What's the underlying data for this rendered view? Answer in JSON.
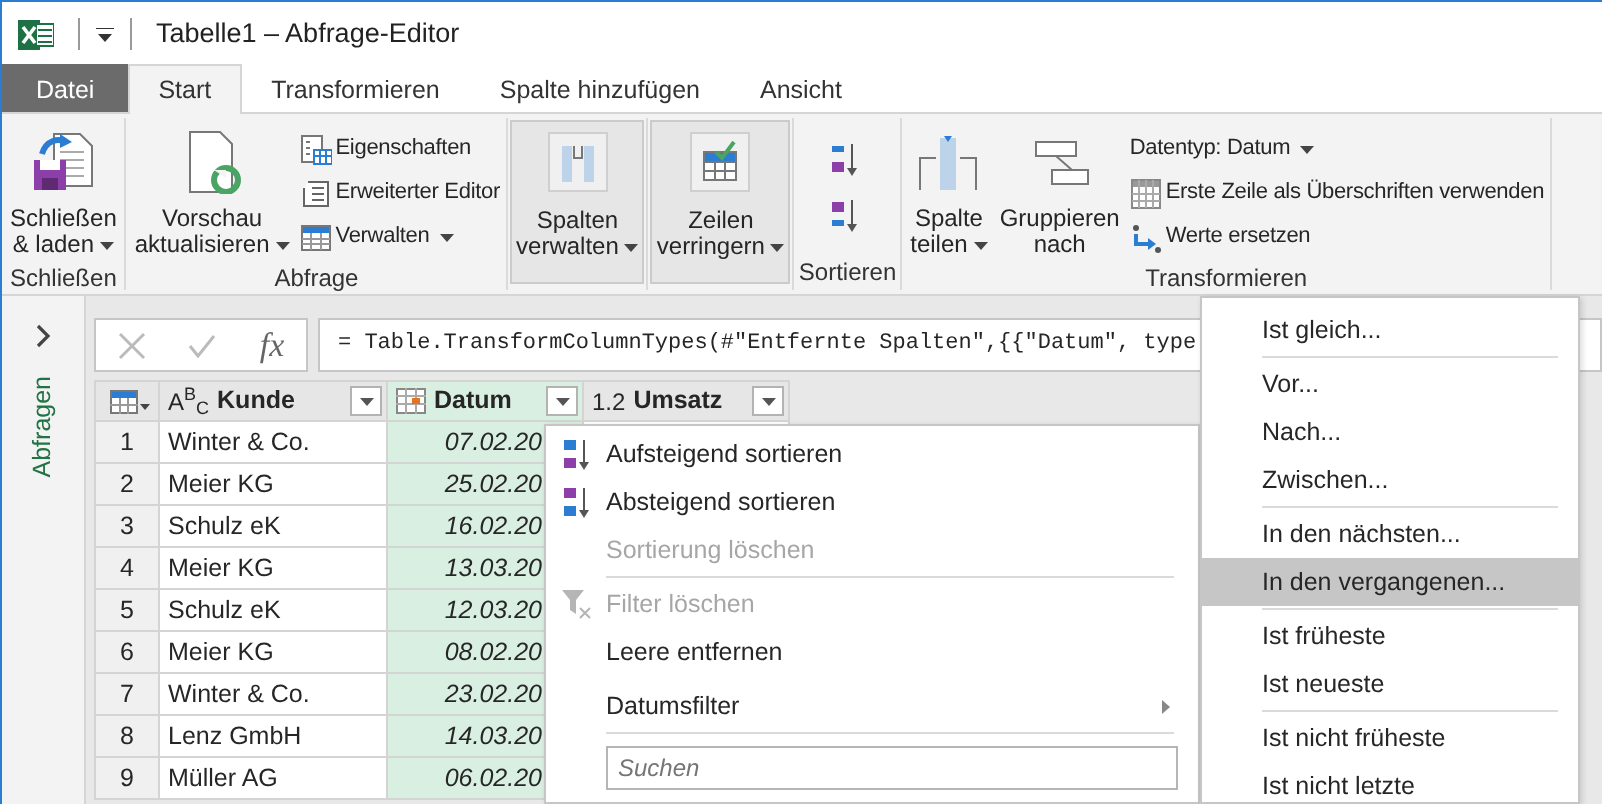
{
  "window": {
    "title": "Tabelle1 – Abfrage-Editor"
  },
  "ribbon_tabs": [
    {
      "label": "Datei",
      "kind": "file",
      "selected": false
    },
    {
      "label": "Start",
      "kind": "tab",
      "selected": true
    },
    {
      "label": "Transformieren",
      "kind": "tab",
      "selected": false
    },
    {
      "label": "Spalte hinzufügen",
      "kind": "tab",
      "selected": false
    },
    {
      "label": "Ansicht",
      "kind": "tab",
      "selected": false
    }
  ],
  "ribbon_groups": [
    {
      "label": "Schließen",
      "controls": [
        {
          "kind": "large",
          "lines": [
            "Schließen",
            "& laden"
          ],
          "dropdown": true
        }
      ]
    },
    {
      "label": "Abfrage",
      "controls": [
        {
          "kind": "large",
          "lines": [
            "Vorschau",
            "aktualisieren"
          ],
          "dropdown": true
        },
        {
          "kind": "stack",
          "items": [
            {
              "label": "Eigenschaften",
              "dropdown": false
            },
            {
              "label": "Erweiterter Editor",
              "dropdown": false
            },
            {
              "label": "Verwalten",
              "dropdown": true
            }
          ]
        }
      ]
    },
    {
      "controls": [
        {
          "kind": "collapsed",
          "lines": [
            "Spalten",
            "verwalten"
          ],
          "dropdown": true
        }
      ]
    },
    {
      "controls": [
        {
          "kind": "collapsed",
          "lines": [
            "Zeilen",
            "verringern"
          ],
          "dropdown": true
        }
      ]
    },
    {
      "label": "Sortieren",
      "controls": [
        {
          "kind": "sort"
        }
      ]
    },
    {
      "label": "Transformieren",
      "controls": [
        {
          "kind": "large",
          "lines": [
            "Spalte",
            "teilen"
          ],
          "dropdown": true
        },
        {
          "kind": "large",
          "lines": [
            "Gruppieren",
            "nach"
          ],
          "dropdown": false
        },
        {
          "kind": "stack",
          "items": [
            {
              "label": "Datentyp: Datum",
              "dropdown": true
            },
            {
              "label": "Erste Zeile als Überschriften verwenden",
              "dropdown": false
            },
            {
              "label": "Werte ersetzen",
              "dropdown": false
            }
          ]
        }
      ]
    }
  ],
  "sidebar": {
    "label": "Abfragen"
  },
  "formula_bar": {
    "function_label": "fx",
    "formula": "= Table.TransformColumnTypes(#\"Entfernte Spalten\",{{\"Datum\", type"
  },
  "table": {
    "columns": [
      {
        "name": "Kunde",
        "type_label": "A$^{B}$$_{C}$",
        "kind": "text",
        "selected": false
      },
      {
        "name": "Datum",
        "kind": "date",
        "selected": true
      },
      {
        "name": "Umsatz",
        "type_label": "1.2",
        "kind": "number",
        "selected": false
      }
    ],
    "rows": [
      {
        "index": "1",
        "cells": [
          "Winter & Co.",
          "07.02.20"
        ]
      },
      {
        "index": "2",
        "cells": [
          "Meier KG",
          "25.02.20"
        ]
      },
      {
        "index": "3",
        "cells": [
          "Schulz eK",
          "16.02.20"
        ]
      },
      {
        "index": "4",
        "cells": [
          "Meier KG",
          "13.03.20"
        ]
      },
      {
        "index": "5",
        "cells": [
          "Schulz eK",
          "12.03.20"
        ]
      },
      {
        "index": "6",
        "cells": [
          "Meier KG",
          "08.02.20"
        ]
      },
      {
        "index": "7",
        "cells": [
          "Winter & Co.",
          "23.02.20"
        ]
      },
      {
        "index": "8",
        "cells": [
          "Lenz GmbH",
          "14.03.20"
        ]
      },
      {
        "index": "9",
        "cells": [
          "Müller AG",
          "06.02.20"
        ]
      }
    ]
  },
  "sort_menu": {
    "items": [
      {
        "kind": "item",
        "label": "Aufsteigend sortieren",
        "disabled": false
      },
      {
        "kind": "item",
        "label": "Absteigend sortieren",
        "disabled": false
      },
      {
        "kind": "item",
        "label": "Sortierung löschen",
        "disabled": true
      },
      {
        "kind": "separator"
      },
      {
        "kind": "item",
        "label": "Filter löschen",
        "disabled": true
      },
      {
        "kind": "item",
        "label": "Leere entfernen",
        "disabled": false
      },
      {
        "kind": "submenu",
        "label": "Datumsfilter",
        "disabled": false
      },
      {
        "kind": "separator"
      },
      {
        "kind": "search",
        "placeholder": "Suchen"
      }
    ]
  },
  "date_filter_menu": {
    "items": [
      {
        "kind": "item",
        "label": "Ist gleich...",
        "selected": false
      },
      {
        "kind": "separator"
      },
      {
        "kind": "item",
        "label": "Vor...",
        "selected": false
      },
      {
        "kind": "item",
        "label": "Nach...",
        "selected": false
      },
      {
        "kind": "item",
        "label": "Zwischen...",
        "selected": false
      },
      {
        "kind": "separator"
      },
      {
        "kind": "item",
        "label": "In den nächsten...",
        "selected": false
      },
      {
        "kind": "item",
        "label": "In den vergangenen...",
        "selected": true
      },
      {
        "kind": "separator"
      },
      {
        "kind": "item",
        "label": "Ist früheste",
        "selected": false
      },
      {
        "kind": "item",
        "label": "Ist neueste",
        "selected": false
      },
      {
        "kind": "separator"
      },
      {
        "kind": "item",
        "label": "Ist nicht früheste",
        "selected": false
      },
      {
        "kind": "item",
        "label": "Ist nicht letzte",
        "selected": false
      }
    ]
  }
}
